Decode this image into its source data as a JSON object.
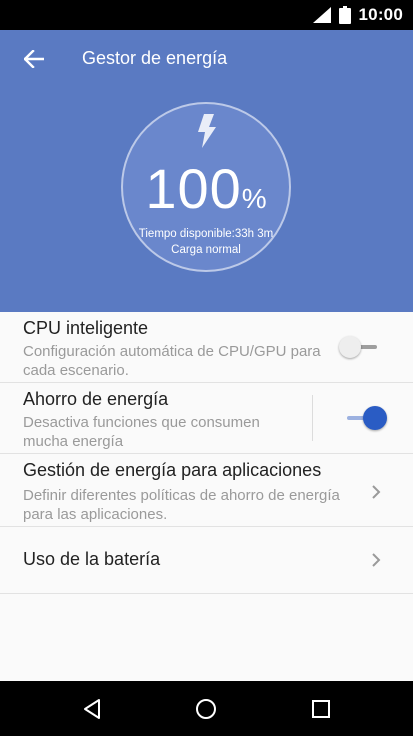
{
  "status_bar": {
    "time": "10:00",
    "icons": [
      "signal-icon",
      "battery-icon"
    ]
  },
  "header": {
    "title": "Gestor de energía",
    "back_icon": "arrow-back-icon"
  },
  "battery": {
    "percent": "100",
    "percent_symbol": "%",
    "time_available": "Tiempo disponible:33h 3m",
    "charge_state": "Carga normal",
    "icon": "bolt-icon"
  },
  "settings": [
    {
      "title": "CPU inteligente",
      "subtitle": "Configuración automática de CPU/GPU para cada escenario.",
      "control": "switch",
      "enabled": false
    },
    {
      "title": "Ahorro de energía",
      "subtitle": "Desactiva funciones que consumen mucha energía",
      "control": "switch",
      "enabled": true
    },
    {
      "title": "Gestión de energía para aplicaciones",
      "subtitle": "Definir diferentes políticas de ahorro de energía para las aplicaciones.",
      "control": "chevron"
    },
    {
      "title": "Uso de la batería",
      "control": "chevron"
    }
  ],
  "nav_bar": {
    "buttons": [
      "back-icon",
      "home-icon",
      "recents-icon"
    ]
  },
  "colors": {
    "header_bg": "#5a7ac2",
    "accent": "#2a5cc4",
    "status_bar": "#000000"
  }
}
